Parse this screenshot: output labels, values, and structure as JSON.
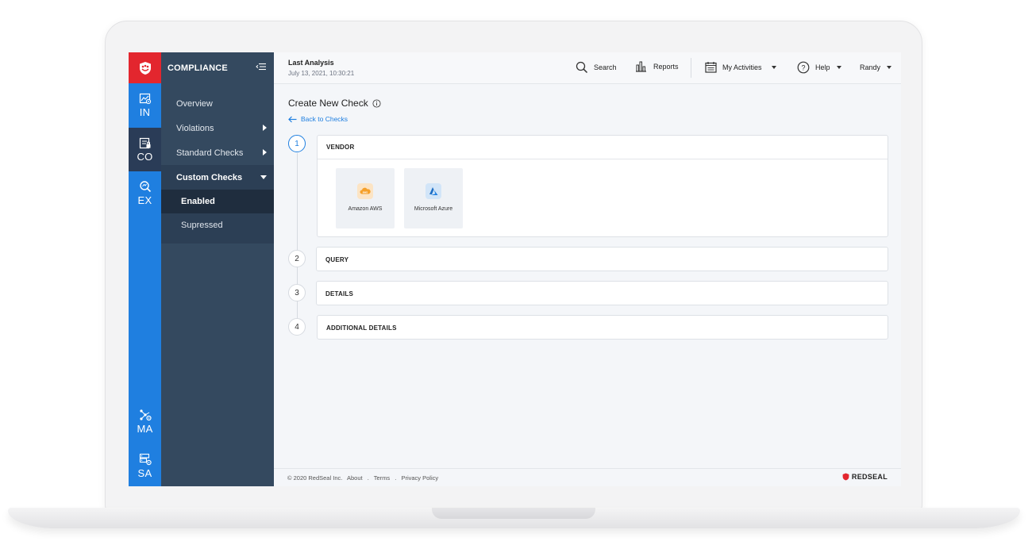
{
  "rail": {
    "items": [
      {
        "label": "IN"
      },
      {
        "label": "CO"
      },
      {
        "label": "EX"
      },
      {
        "label": "MA"
      },
      {
        "label": "SA"
      }
    ],
    "brand_color": "#e3262e",
    "accent_color": "#1f7fe0"
  },
  "nav": {
    "title": "COMPLIANCE",
    "items": [
      {
        "label": "Overview"
      },
      {
        "label": "Violations"
      },
      {
        "label": "Standard Checks"
      },
      {
        "label": "Custom Checks"
      }
    ],
    "sub_items": [
      {
        "label": "Enabled"
      },
      {
        "label": "Supressed"
      }
    ]
  },
  "topbar": {
    "last_analysis_title": "Last Analysis",
    "last_analysis_date": "July 13, 2021, 10:30:21",
    "search_label": "Search",
    "reports_label": "Reports",
    "activities_label": "My Activities",
    "help_label": "Help",
    "user_label": "Randy"
  },
  "page": {
    "title": "Create New Check",
    "back_label": "Back to Checks"
  },
  "steps": [
    {
      "num": "1",
      "label": "VENDOR"
    },
    {
      "num": "2",
      "label": "QUERY"
    },
    {
      "num": "3",
      "label": "DETAILS"
    },
    {
      "num": "4",
      "label": "ADDITIONAL DETAILS"
    }
  ],
  "vendors": [
    {
      "label": "Amazon AWS",
      "icon": "aws-icon",
      "color": "#f5a02a"
    },
    {
      "label": "Microsoft Azure",
      "icon": "azure-icon",
      "color": "#1f7fe0"
    }
  ],
  "footer": {
    "copyright": "© 2020 RedSeal Inc.",
    "about": "About",
    "terms": "Terms",
    "privacy": "Privacy Policy",
    "sep": ".",
    "brand": "REDSEAL"
  }
}
